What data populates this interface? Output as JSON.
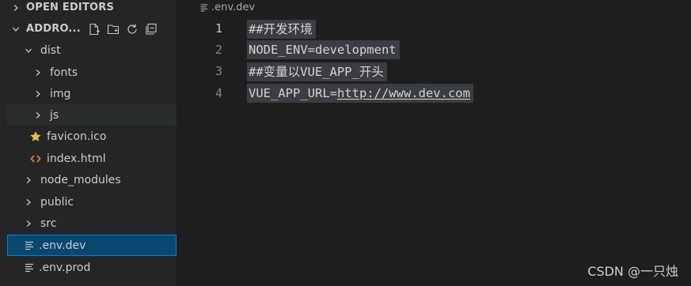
{
  "explorer": {
    "open_editors_label": "OPEN EDITORS",
    "project_label": "ADDRO...",
    "tree": [
      {
        "name": "dist",
        "kind": "folder-open",
        "depth": 1
      },
      {
        "name": "fonts",
        "kind": "folder",
        "depth": 2
      },
      {
        "name": "img",
        "kind": "folder",
        "depth": 2
      },
      {
        "name": "js",
        "kind": "folder",
        "depth": 2
      },
      {
        "name": "favicon.ico",
        "kind": "file-star",
        "depth": 2
      },
      {
        "name": "index.html",
        "kind": "file-html",
        "depth": 2
      },
      {
        "name": "node_modules",
        "kind": "folder",
        "depth": 1
      },
      {
        "name": "public",
        "kind": "folder",
        "depth": 1
      },
      {
        "name": "src",
        "kind": "folder",
        "depth": 1
      },
      {
        "name": ".env.dev",
        "kind": "file-lines",
        "depth": 1,
        "selected": true
      },
      {
        "name": ".env.prod",
        "kind": "file-lines",
        "depth": 1
      }
    ],
    "toolbar_icons": [
      "new-file-icon",
      "new-folder-icon",
      "refresh-icon",
      "collapse-all-icon"
    ]
  },
  "editor": {
    "breadcrumb": ".env.dev",
    "active_line": 1,
    "lines": [
      {
        "no": "1",
        "text": "##开发环境"
      },
      {
        "no": "2",
        "text": "NODE_ENV=development"
      },
      {
        "no": "3",
        "text": "##变量以VUE_APP_开头"
      },
      {
        "no": "4",
        "prefix": "VUE_APP_URL=",
        "link": "http://www.dev.com"
      }
    ]
  },
  "watermark": "CSDN @一只烛",
  "colors": {
    "selection": "#094771",
    "selection_border": "#007fd4",
    "favicon_star": "#e2c541",
    "html_icon": "#e37933"
  }
}
